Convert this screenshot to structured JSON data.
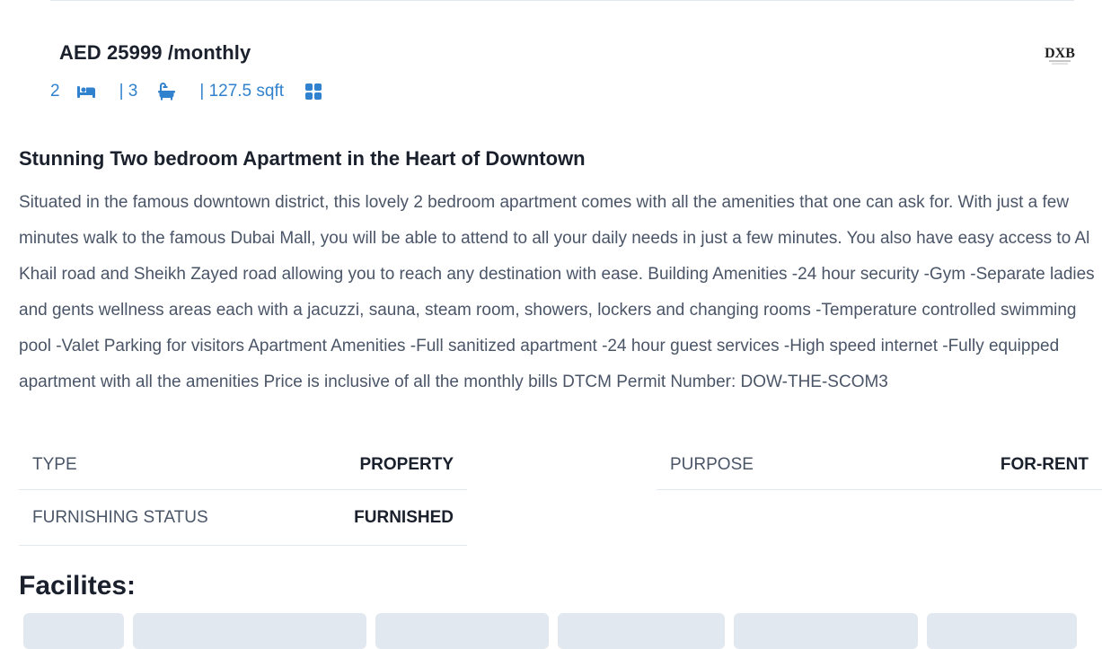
{
  "price": "AED 25999 /monthly",
  "stats": {
    "rooms": "2",
    "baths": "| 3",
    "area": "| 127.5 sqft"
  },
  "title": "Stunning Two bedroom Apartment in the Heart of Downtown",
  "description": "Situated in the famous downtown district, this lovely 2 bedroom apartment comes with all the amenities that one can ask for. With just a few minutes walk to the  famous Dubai Mall, you will be able to attend to all your daily needs in just a few minutes. You also have easy access to Al Khail road and Sheikh Zayed road allowing you to reach any destination with ease. Building Amenities -24 hour security -Gym -Separate ladies and gents wellness areas each with a jacuzzi, sauna, steam room, showers, lockers and changing rooms -Temperature controlled swimming pool -Valet Parking for visitors Apartment Amenities -Full sanitized apartment -24 hour guest services -High speed internet -Fully equipped apartment with all the amenities Price is inclusive of all the monthly bills DTCM Permit Number: DOW-THE-SCOM3",
  "details": {
    "type_label": "TYPE",
    "type_value": "PROPERTY",
    "purpose_label": "PURPOSE",
    "purpose_value": "FOR-RENT",
    "furnishing_label": "FURNISHING STATUS",
    "furnishing_value": "FURNISHED"
  },
  "facilities_heading": "Facilites:",
  "agency_logo_text": "DXB",
  "colors": {
    "accent": "#3182ce",
    "chip": "#e2e8f0",
    "text": "#1a202c",
    "muted": "#4a5568"
  },
  "icons": [
    "bed-icon",
    "bath-icon",
    "area-grid-icon"
  ]
}
